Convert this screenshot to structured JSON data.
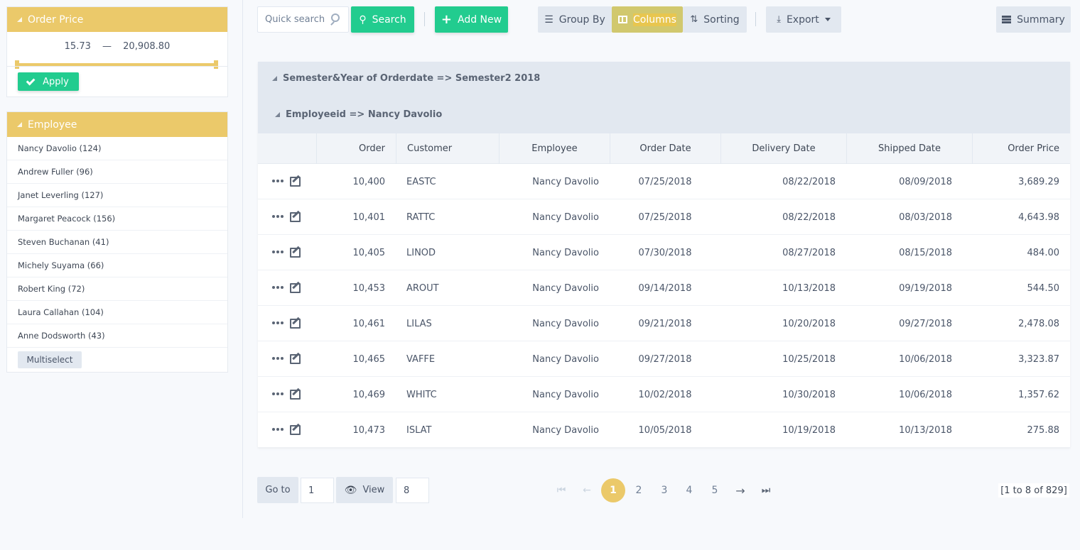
{
  "sidebar": {
    "price_filter": {
      "title": "Order Price",
      "min": "15.73",
      "dash": "—",
      "max": "20,908.80",
      "apply_label": "Apply"
    },
    "employee_filter": {
      "title": "Employee",
      "items": [
        "Nancy Davolio (124)",
        "Andrew Fuller (96)",
        "Janet Leverling (127)",
        "Margaret Peacock (156)",
        "Steven Buchanan (41)",
        "Michely Suyama (66)",
        "Robert King (72)",
        "Laura Callahan (104)",
        "Anne Dodsworth (43)"
      ],
      "multiselect_label": "Multiselect"
    }
  },
  "toolbar": {
    "search_placeholder": "Quick search",
    "search_label": "Search",
    "add_label": "Add New",
    "group_label": "Group By",
    "columns_label": "Columns",
    "sorting_label": "Sorting",
    "export_label": "Export",
    "summary_label": "Summary"
  },
  "grid": {
    "groups": [
      "Semester&Year of Orderdate => Semester2 2018",
      "Employeeid => Nancy Davolio"
    ],
    "columns": [
      "Order",
      "Customer",
      "Employee",
      "Order Date",
      "Delivery Date",
      "Shipped Date",
      "Order Price"
    ],
    "rows": [
      {
        "order": "10,400",
        "customer": "EASTC",
        "employee": "Nancy Davolio",
        "order_date": "07/25/2018",
        "delivery_date": "08/22/2018",
        "shipped_date": "08/09/2018",
        "price": "3,689.29"
      },
      {
        "order": "10,401",
        "customer": "RATTC",
        "employee": "Nancy Davolio",
        "order_date": "07/25/2018",
        "delivery_date": "08/22/2018",
        "shipped_date": "08/03/2018",
        "price": "4,643.98"
      },
      {
        "order": "10,405",
        "customer": "LINOD",
        "employee": "Nancy Davolio",
        "order_date": "07/30/2018",
        "delivery_date": "08/27/2018",
        "shipped_date": "08/15/2018",
        "price": "484.00"
      },
      {
        "order": "10,453",
        "customer": "AROUT",
        "employee": "Nancy Davolio",
        "order_date": "09/14/2018",
        "delivery_date": "10/13/2018",
        "shipped_date": "09/19/2018",
        "price": "544.50"
      },
      {
        "order": "10,461",
        "customer": "LILAS",
        "employee": "Nancy Davolio",
        "order_date": "09/21/2018",
        "delivery_date": "10/20/2018",
        "shipped_date": "09/27/2018",
        "price": "2,478.08"
      },
      {
        "order": "10,465",
        "customer": "VAFFE",
        "employee": "Nancy Davolio",
        "order_date": "09/27/2018",
        "delivery_date": "10/25/2018",
        "shipped_date": "10/06/2018",
        "price": "3,323.87"
      },
      {
        "order": "10,469",
        "customer": "WHITC",
        "employee": "Nancy Davolio",
        "order_date": "10/02/2018",
        "delivery_date": "10/30/2018",
        "shipped_date": "10/06/2018",
        "price": "1,357.62"
      },
      {
        "order": "10,473",
        "customer": "ISLAT",
        "employee": "Nancy Davolio",
        "order_date": "10/05/2018",
        "delivery_date": "10/19/2018",
        "shipped_date": "10/13/2018",
        "price": "275.88"
      }
    ]
  },
  "pager": {
    "goto_label": "Go to",
    "goto_value": "1",
    "view_label": "View",
    "view_value": "8",
    "pages": [
      "1",
      "2",
      "3",
      "4",
      "5"
    ],
    "active_page": "1",
    "info": "[1 to 8 of 829]"
  },
  "colors": {
    "accent_gold": "#ebc96a",
    "accent_green": "#22cc8f"
  }
}
